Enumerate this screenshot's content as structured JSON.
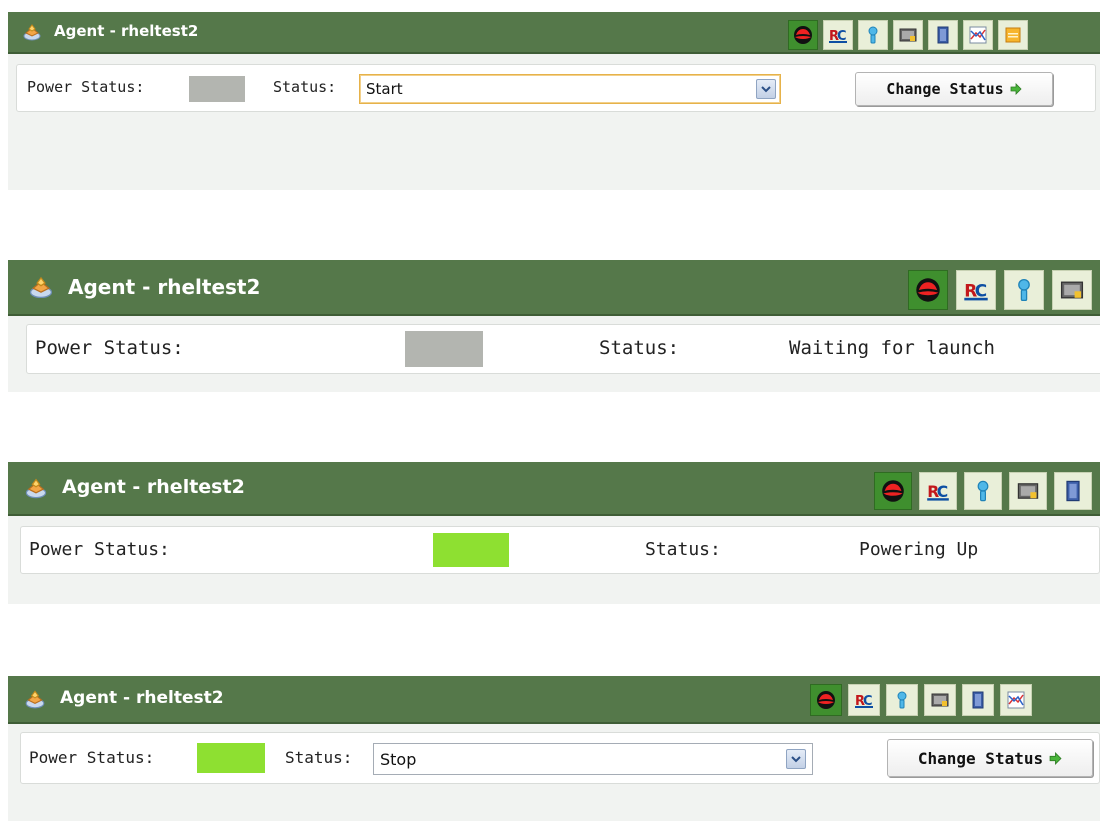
{
  "colors": {
    "titlebar": "#55784a",
    "toolbar_active": "#3f8f2e",
    "power_off": "#b3b5b0",
    "power_on": "#8ee031",
    "arrow_green": "#49b53a"
  },
  "toolbar_icons": [
    "redhat-icon",
    "rc-icon",
    "info-icon",
    "console-icon",
    "book-icon",
    "chart-icon",
    "notes-icon"
  ],
  "panels": [
    {
      "title": "Agent -  rheltest2",
      "power_label": "Power Status:",
      "power_state": "off",
      "status_label": "Status:",
      "status_select_value": "Start",
      "change_status_label": "Change Status"
    },
    {
      "title": "Agent -  rheltest2",
      "power_label": "Power Status:",
      "power_state": "off",
      "status_label": "Status:",
      "status_text": "Waiting for launch"
    },
    {
      "title": "Agent -  rheltest2",
      "power_label": "Power Status:",
      "power_state": "on",
      "status_label": "Status:",
      "status_text": "Powering Up"
    },
    {
      "title": "Agent -  rheltest2",
      "power_label": "Power Status:",
      "power_state": "on",
      "status_label": "Status:",
      "status_select_value": "Stop",
      "change_status_label": "Change Status"
    }
  ]
}
